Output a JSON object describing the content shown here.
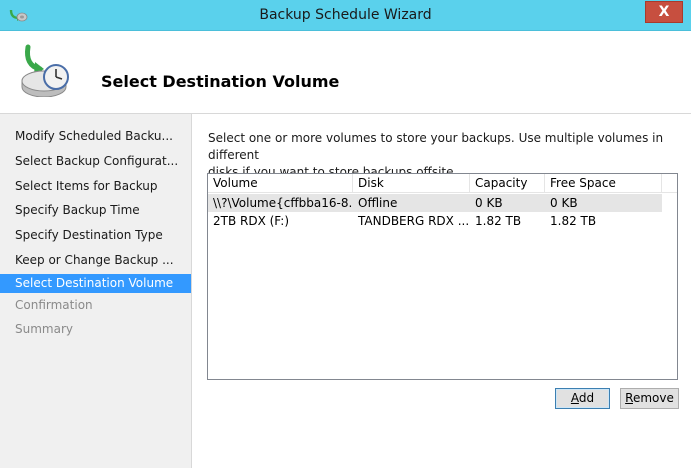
{
  "window": {
    "title": "Backup Schedule Wizard",
    "close_label": "X",
    "icons": {
      "app": "backup-app-icon",
      "header": "backup-schedule-icon"
    }
  },
  "header": {
    "title": "Select Destination Volume"
  },
  "nav": {
    "items": [
      {
        "label": "Modify Scheduled Backu...",
        "state": "normal"
      },
      {
        "label": "Select Backup Configurat...",
        "state": "normal"
      },
      {
        "label": "Select Items for Backup",
        "state": "normal"
      },
      {
        "label": "Specify Backup Time",
        "state": "normal"
      },
      {
        "label": "Specify Destination Type",
        "state": "normal"
      },
      {
        "label": "Keep or Change Backup ...",
        "state": "normal"
      },
      {
        "label": "Select Destination Volume",
        "state": "active"
      },
      {
        "label": "Confirmation",
        "state": "disabled"
      },
      {
        "label": "Summary",
        "state": "disabled"
      }
    ]
  },
  "main": {
    "description_line1": "Select one or more volumes to store your backups. Use multiple volumes in different",
    "description_line2": "disks if you want to store backups offsite.",
    "table": {
      "columns": [
        "Volume",
        "Disk",
        "Capacity",
        "Free Space"
      ],
      "rows": [
        [
          "\\\\?\\Volume{cffbba16-8...",
          "Offline",
          "0 KB",
          "0 KB"
        ],
        [
          "2TB RDX (F:)",
          "TANDBERG RDX ...",
          "1.82 TB",
          "1.82 TB"
        ]
      ]
    },
    "buttons": {
      "add": {
        "mnemonic": "A",
        "rest": "dd"
      },
      "remove": {
        "mnemonic": "R",
        "rest": "emove"
      }
    }
  },
  "colors": {
    "titlebar": "#5ad1ec",
    "close": "#c74f3f",
    "nav_active": "#3399ff",
    "nav_bg": "#f0f0f0"
  }
}
